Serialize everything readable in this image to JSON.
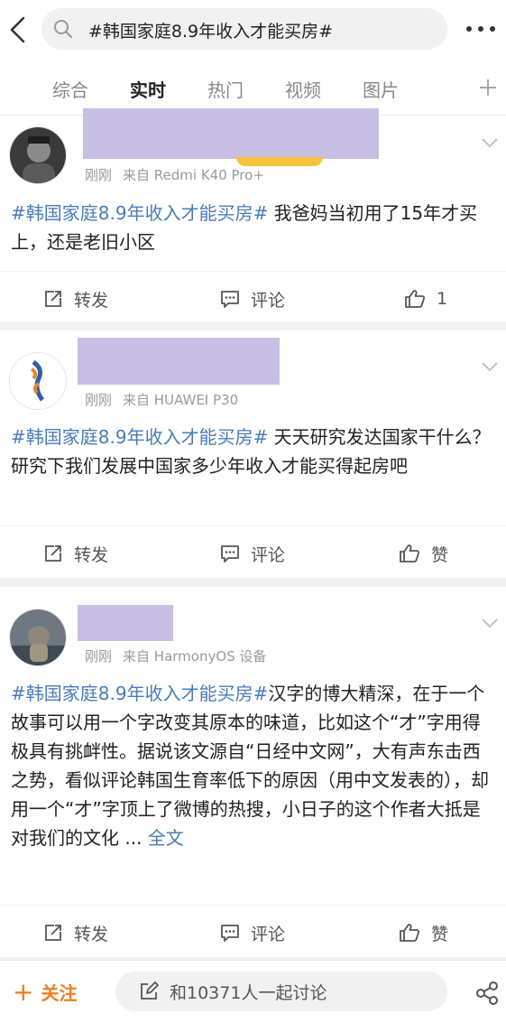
{
  "search": {
    "query": "#韩国家庭8.9年收入才能买房#"
  },
  "tabs": [
    {
      "label": "综合"
    },
    {
      "label": "实时"
    },
    {
      "label": "热门"
    },
    {
      "label": "视频"
    },
    {
      "label": "图片"
    }
  ],
  "active_tab": "实时",
  "posts": [
    {
      "time": "刚刚",
      "source": "来自 Redmi K40 Pro+",
      "hashtag": "#韩国家庭8.9年收入才能买房#",
      "body": " 我爸妈当初用了15年才买上，还是老旧小区",
      "repost_label": "转发",
      "comment_label": "评论",
      "like_label": "1"
    },
    {
      "time": "刚刚",
      "source": "来自 HUAWEI P30",
      "hashtag": "#韩国家庭8.9年收入才能买房#",
      "body": " 天天研究发达国家干什么？研究下我们发展中国家多少年收入才能买得起房吧",
      "repost_label": "转发",
      "comment_label": "评论",
      "like_label": "赞"
    },
    {
      "time": "刚刚",
      "source": "来自 HarmonyOS 设备",
      "hashtag": "#韩国家庭8.9年收入才能买房#",
      "body": "汉字的博大精深，在于一个故事可以用一个字改变其原本的味道，比如这个“才”字用得极具有挑衅性。据说该文源自“日经中文网”，大有声东击西之势，看似评论韩国生育率低下的原因（用中文发表的），却用一个“才”字顶上了微博的热搜，小日子的这个作者大抵是对我们的文化 ...",
      "fulltext_label": "全文",
      "repost_label": "转发",
      "comment_label": "评论",
      "like_label": "赞"
    }
  ],
  "bottom": {
    "follow_label": "关注",
    "discuss_placeholder": "和10371人一起讨论"
  },
  "colors": {
    "hashtag": "#4a7cb8",
    "follow": "#f07d1c",
    "redaction": "#c8bfe4"
  }
}
